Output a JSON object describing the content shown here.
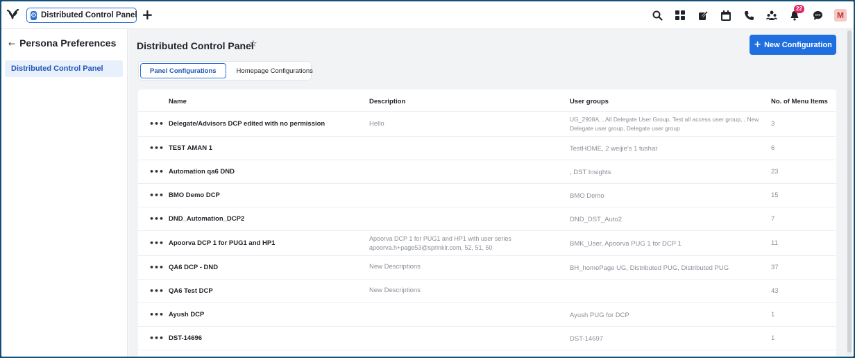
{
  "topbar": {
    "tab_label": "Distributed Control Panel",
    "notification_count": "22",
    "avatar_letter": "M"
  },
  "left_panel": {
    "title": "Persona Preferences",
    "items": [
      {
        "label": "Distributed Control Panel",
        "selected": true
      }
    ]
  },
  "main": {
    "title": "Distributed Control Panel",
    "new_button": "New Configuration",
    "tabs": [
      {
        "label": "Panel Configurations",
        "active": true
      },
      {
        "label": "Homepage Configurations",
        "active": false
      }
    ],
    "table": {
      "headers": {
        "name": "Name",
        "description": "Description",
        "user_groups": "User groups",
        "menu_items": "No. of Menu Items"
      },
      "rows": [
        {
          "actions": "•••",
          "name": "Delegate/Advisors DCP edited with no permission",
          "description": "Hello",
          "user_groups": "UG_2908A, , All Delegate User Group, Test all access user group, , New Delegate user group, Delegate user group",
          "menu_items": "3"
        },
        {
          "actions": "•••",
          "name": "TEST AMAN 1",
          "description": "",
          "user_groups": "TestHOME, 2 weijie's 1 tushar",
          "menu_items": "6"
        },
        {
          "actions": "•••",
          "name": "Automation qa6 DND",
          "description": "",
          "user_groups": ", DST Insights",
          "menu_items": "23"
        },
        {
          "actions": "•••",
          "name": "BMO Demo DCP",
          "description": "",
          "user_groups": "BMO Demo",
          "menu_items": "15"
        },
        {
          "actions": "•••",
          "name": "DND_Automation_DCP2",
          "description": "",
          "user_groups": "DND_DST_Auto2",
          "menu_items": "7"
        },
        {
          "actions": "•••",
          "name": "Apoorva DCP 1 for PUG1 and HP1",
          "description": "Apoorva DCP 1 for PUG1 and HP1 with user series apoorva.h+page53@sprinklr.com, 52, 51, 50",
          "user_groups": "BMK_User, Apoorva PUG 1 for DCP 1",
          "menu_items": "11"
        },
        {
          "actions": "•••",
          "name": "QA6 DCP - DND",
          "description": "New Descriptions",
          "user_groups": "BH_homePage UG, Distributed PUG, Distributed PUG",
          "menu_items": "37"
        },
        {
          "actions": "•••",
          "name": "QA6 Test DCP",
          "description": "New Descriptions",
          "user_groups": "",
          "menu_items": "43"
        },
        {
          "actions": "•••",
          "name": "Ayush DCP",
          "description": "",
          "user_groups": "Ayush PUG for DCP",
          "menu_items": "1"
        },
        {
          "actions": "•••",
          "name": "DST-14696",
          "description": "",
          "user_groups": "DST-14697",
          "menu_items": "1"
        }
      ]
    }
  },
  "colors": {
    "accent": "#1f6fe0",
    "selected_bg": "#e8f0fc",
    "frame": "#12507a"
  }
}
